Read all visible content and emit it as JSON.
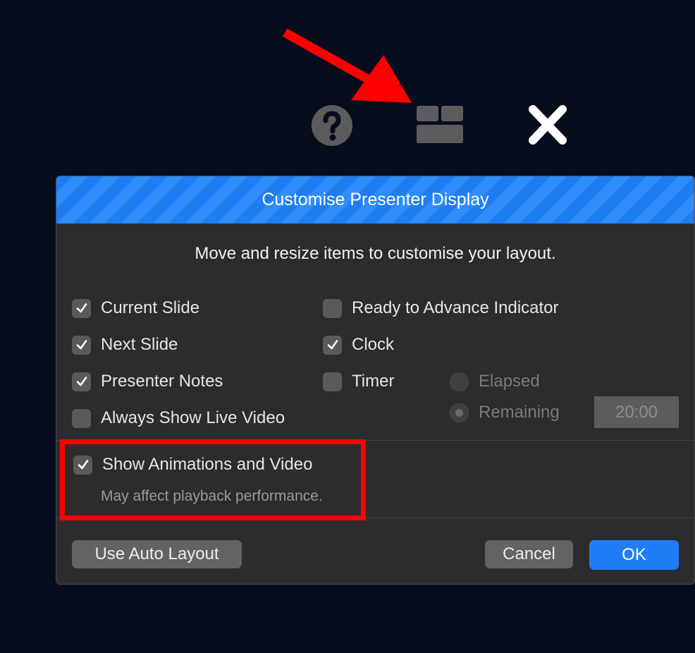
{
  "dialog": {
    "title": "Customise Presenter Display",
    "instructions": "Move and resize items to customise your layout."
  },
  "options": {
    "current_slide": {
      "label": "Current Slide",
      "checked": true
    },
    "next_slide": {
      "label": "Next Slide",
      "checked": true
    },
    "presenter_notes": {
      "label": "Presenter Notes",
      "checked": true
    },
    "always_show_live_video": {
      "label": "Always Show Live Video",
      "checked": false
    },
    "ready_to_advance": {
      "label": "Ready to Advance Indicator",
      "checked": false
    },
    "clock": {
      "label": "Clock",
      "checked": true
    },
    "timer": {
      "label": "Timer",
      "checked": false
    },
    "show_animations": {
      "label": "Show Animations and Video",
      "checked": true,
      "hint": "May affect playback performance."
    }
  },
  "timer_mode": {
    "elapsed_label": "Elapsed",
    "remaining_label": "Remaining",
    "selected": "Remaining",
    "duration": "20:00"
  },
  "buttons": {
    "auto_layout": "Use Auto Layout",
    "cancel": "Cancel",
    "ok": "OK"
  },
  "toolbar": {
    "icons": [
      "help-icon",
      "layout-icon",
      "close-icon"
    ]
  },
  "colors": {
    "accent": "#1f7df4",
    "highlight": "#ff0000",
    "background": "#050c1c",
    "dialog": "#2c2c2e"
  }
}
